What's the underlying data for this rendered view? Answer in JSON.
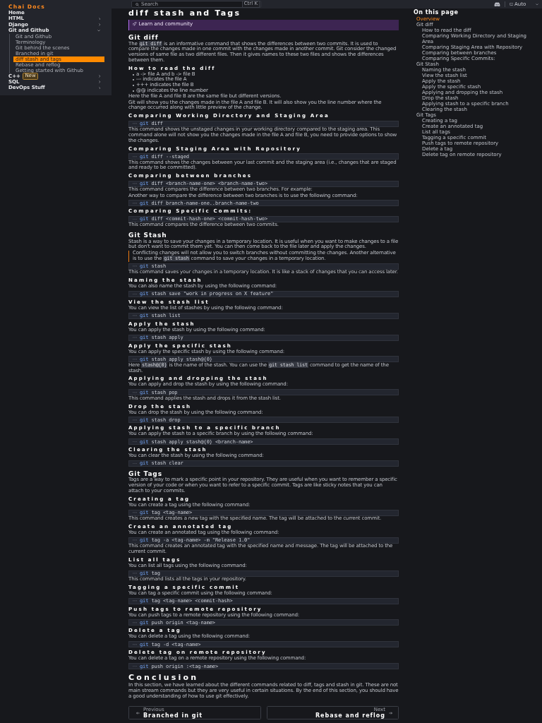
{
  "header": {
    "logo": "Chai Docs",
    "search": {
      "label": "Search",
      "shortcut": "Ctrl K"
    },
    "theme": {
      "value": "Auto"
    }
  },
  "sidebar": {
    "items": [
      {
        "label": "Home",
        "selected": false
      },
      {
        "label": "HTML",
        "selected": false,
        "expanded": false
      },
      {
        "label": "Django",
        "selected": false,
        "expanded": false
      },
      {
        "label": "Git and Github",
        "selected": false,
        "expanded": true,
        "children": [
          {
            "label": "Git and Github",
            "selected": false
          },
          {
            "label": "Terminology",
            "selected": false
          },
          {
            "label": "Git behind the scenes",
            "selected": false
          },
          {
            "label": "Branched in git",
            "selected": false
          },
          {
            "label": "diff stash and tags",
            "selected": true
          },
          {
            "label": "Rebase and reflog",
            "selected": false
          },
          {
            "label": "Getting started with Github",
            "selected": false
          }
        ]
      },
      {
        "label": "C++",
        "badge": "New",
        "selected": false,
        "expanded": false
      },
      {
        "label": "SQL",
        "selected": false,
        "expanded": false
      },
      {
        "label": "DevOps Stuff",
        "selected": false,
        "expanded": false
      }
    ]
  },
  "article": {
    "title": "diff stash and Tags",
    "blocks": [
      {
        "kind": "aside",
        "title": "Learn and community"
      },
      {
        "kind": "h2",
        "text": "Git diff"
      },
      {
        "kind": "p",
        "parts": [
          {
            "kind": "text",
            "text": "The "
          },
          {
            "kind": "code",
            "text": "git diff"
          },
          {
            "kind": "text",
            "text": " is an informative command that shows the differences between two commits. It is used to compare the changes made in one commit with the changes made in another commit. Git consider the changed versions of same file as two different files. Then it gives names to these two files and shows the differences between them."
          }
        ]
      },
      {
        "kind": "h3",
        "text": "How to read the diff"
      },
      {
        "kind": "list",
        "items": [
          "a -> file A and b -> file B",
          "--- indicates the file A",
          "+++ indicates the file B",
          "@@ indicates the line number"
        ]
      },
      {
        "kind": "p",
        "text": "Here the file A and file B are the same file but different versions."
      },
      {
        "kind": "p",
        "text": "Git will show you the changes made in the file A and file B. It will also show you the line number where the change occurred along with little preview of the change."
      },
      {
        "kind": "h3",
        "text": "Comparing Working Directory and Staging Area"
      },
      {
        "kind": "code",
        "text": "git diff"
      },
      {
        "kind": "p",
        "text": "This command shows the unstaged changes in your working directory compared to the staging area. This command alone will not show you the changes made in the file A and file B, you need to provide options to show the changes."
      },
      {
        "kind": "h3",
        "text": "Comparing Staging Area with Repository"
      },
      {
        "kind": "code",
        "text": "git diff --staged"
      },
      {
        "kind": "p",
        "text": "This command shows the changes between your last commit and the staging area (i.e., changes that are staged and ready to be committed)."
      },
      {
        "kind": "h3",
        "text": "Comparing between branches"
      },
      {
        "kind": "code",
        "text": "git diff <branch-name-one> <branch-name-two>"
      },
      {
        "kind": "p",
        "text": "This command compares the difference between two branches. For example:"
      },
      {
        "kind": "p",
        "text": "Another way to compare the difference between two branches is to use the following command:"
      },
      {
        "kind": "code",
        "text": "git diff branch-name-one..branch-name-two"
      },
      {
        "kind": "h3",
        "text": "Comparing Specific Commits:"
      },
      {
        "kind": "code",
        "text": "git diff <commit-hash-one> <commit-hash-two>"
      },
      {
        "kind": "p",
        "text": "This command compares the difference between two commits."
      },
      {
        "kind": "h2",
        "text": "Git Stash"
      },
      {
        "kind": "p",
        "text": "Stash is a way to save your changes in a temporary location. It is useful when you want to make changes to a file but don't want to commit them yet. You can then come back to the file later and apply the changes."
      },
      {
        "kind": "quote",
        "parts": [
          {
            "kind": "text",
            "text": "Conflicting changes will not allow you to switch branches without committing the changes. Another alternative is to use the "
          },
          {
            "kind": "code",
            "text": "git stash"
          },
          {
            "kind": "text",
            "text": " command to save your changes in a temporary location."
          }
        ]
      },
      {
        "kind": "code",
        "text": "git stash"
      },
      {
        "kind": "p",
        "text": "This command saves your changes in a temporary location. It is like a stack of changes that you can access later."
      },
      {
        "kind": "h3",
        "text": "Naming the stash"
      },
      {
        "kind": "p",
        "text": "You can also name the stash by using the following command:"
      },
      {
        "kind": "code",
        "text": "git stash save \"work in progress on X feature\""
      },
      {
        "kind": "h3",
        "text": "View the stash list"
      },
      {
        "kind": "p",
        "text": "You can view the list of stashes by using the following command:"
      },
      {
        "kind": "code",
        "text": "git stash list"
      },
      {
        "kind": "h3",
        "text": "Apply the stash"
      },
      {
        "kind": "p",
        "text": "You can apply the stash by using the following command:"
      },
      {
        "kind": "code",
        "text": "git stash apply"
      },
      {
        "kind": "h3",
        "text": "Apply the specific stash"
      },
      {
        "kind": "p",
        "text": "You can apply the specific stash by using the following command:"
      },
      {
        "kind": "code",
        "text": "git stash apply stash@{0}"
      },
      {
        "kind": "p",
        "parts": [
          {
            "kind": "text",
            "text": "Here "
          },
          {
            "kind": "code",
            "text": "stash@{0}"
          },
          {
            "kind": "text",
            "text": " is the name of the stash. You can use the "
          },
          {
            "kind": "code",
            "text": "git stash list"
          },
          {
            "kind": "text",
            "text": " command to get the name of the stash."
          }
        ]
      },
      {
        "kind": "h3",
        "text": "Applying and dropping the stash"
      },
      {
        "kind": "p",
        "text": "You can apply and drop the stash by using the following command:"
      },
      {
        "kind": "code",
        "text": "git stash pop"
      },
      {
        "kind": "p",
        "text": "This command applies the stash and drops it from the stash list."
      },
      {
        "kind": "h3",
        "text": "Drop the stash"
      },
      {
        "kind": "p",
        "text": "You can drop the stash by using the following command:"
      },
      {
        "kind": "code",
        "text": "git stash drop"
      },
      {
        "kind": "h3",
        "text": "Applying stash to a specific branch"
      },
      {
        "kind": "p",
        "text": "You can apply the stash to a specific branch by using the following command:"
      },
      {
        "kind": "code",
        "text": "git stash apply stash@{0} <branch-name>"
      },
      {
        "kind": "h3",
        "text": "Clearing the stash"
      },
      {
        "kind": "p",
        "text": "You can clear the stash by using the following command:"
      },
      {
        "kind": "code",
        "text": "git stash clear"
      },
      {
        "kind": "h2",
        "text": "Git Tags"
      },
      {
        "kind": "p",
        "text": "Tags are a way to mark a specific point in your repository. They are useful when you want to remember a specific version of your code or when you want to refer to a specific commit. Tags are like sticky notes that you can attach to your commits."
      },
      {
        "kind": "h3",
        "text": "Creating a tag"
      },
      {
        "kind": "p",
        "text": "You can create a tag using the following command:"
      },
      {
        "kind": "code",
        "text": "git tag <tag-name>"
      },
      {
        "kind": "p",
        "text": "This command creates a new tag with the specified name. The tag will be attached to the current commit."
      },
      {
        "kind": "h3",
        "text": "Create an annotated tag"
      },
      {
        "kind": "p",
        "text": "You can create an annotated tag using the following command:"
      },
      {
        "kind": "code",
        "text": "git tag -a <tag-name> -m \"Release 1.0\""
      },
      {
        "kind": "p",
        "text": "This command creates an annotated tag with the specified name and message. The tag will be attached to the current commit."
      },
      {
        "kind": "h3",
        "text": "List all tags"
      },
      {
        "kind": "p",
        "text": "You can list all tags using the following command:"
      },
      {
        "kind": "code",
        "text": "git tag"
      },
      {
        "kind": "p",
        "text": "This command lists all the tags in your repository."
      },
      {
        "kind": "h3",
        "text": "Tagging a specific commit"
      },
      {
        "kind": "p",
        "text": "You can tag a specific commit using the following command:"
      },
      {
        "kind": "code",
        "text": "git tag <tag-name> <commit-hash>"
      },
      {
        "kind": "h3",
        "text": "Push tags to remote repository"
      },
      {
        "kind": "p",
        "text": "You can push tags to a remote repository using the following command:"
      },
      {
        "kind": "code",
        "text": "git push origin <tag-name>"
      },
      {
        "kind": "h3",
        "text": "Delete a tag"
      },
      {
        "kind": "p",
        "text": "You can delete a tag using the following command:"
      },
      {
        "kind": "code",
        "text": "git tag -d <tag-name>"
      },
      {
        "kind": "h3",
        "text": "Delete tag on remote repository"
      },
      {
        "kind": "p",
        "text": "You can delete a tag on a remote repository using the following command:"
      },
      {
        "kind": "code",
        "text": "git push origin :<tag-name>"
      },
      {
        "kind": "h1",
        "text": "Conclusion"
      },
      {
        "kind": "p",
        "text": "In this section, we have learned about the different commands related to diff, tags and stash in git. These are not main stream commands but they are very useful in certain situations. By the end of this section, you should have a good understanding of how to use git effectively."
      }
    ]
  },
  "pagination": {
    "previous": {
      "caption": "Previous",
      "title": "Branched in git"
    },
    "next": {
      "caption": "Next",
      "title": "Rebase and reflog"
    }
  },
  "toc": {
    "title": "On this page",
    "items": [
      {
        "label": "Overview",
        "selected": true
      },
      {
        "label": "Git diff",
        "selected": false,
        "children": [
          {
            "label": "How to read the diff",
            "selected": false
          },
          {
            "label": "Comparing Working Directory and Staging Area",
            "selected": false
          },
          {
            "label": "Comparing Staging Area with Repository",
            "selected": false
          },
          {
            "label": "Comparing between branches",
            "selected": false
          },
          {
            "label": "Comparing Specific Commits:",
            "selected": false
          }
        ]
      },
      {
        "label": "Git Stash",
        "selected": false,
        "children": [
          {
            "label": "Naming the stash",
            "selected": false
          },
          {
            "label": "View the stash list",
            "selected": false
          },
          {
            "label": "Apply the stash",
            "selected": false
          },
          {
            "label": "Apply the specific stash",
            "selected": false
          },
          {
            "label": "Applying and dropping the stash",
            "selected": false
          },
          {
            "label": "Drop the stash",
            "selected": false
          },
          {
            "label": "Applying stash to a specific branch",
            "selected": false
          },
          {
            "label": "Clearing the stash",
            "selected": false
          }
        ]
      },
      {
        "label": "Git Tags",
        "selected": false,
        "children": [
          {
            "label": "Creating a tag",
            "selected": false
          },
          {
            "label": "Create an annotated tag",
            "selected": false
          },
          {
            "label": "List all tags",
            "selected": false
          },
          {
            "label": "Tagging a specific commit",
            "selected": false
          },
          {
            "label": "Push tags to remote repository",
            "selected": false
          },
          {
            "label": "Delete a tag",
            "selected": false
          },
          {
            "label": "Delete tag on remote repository",
            "selected": false
          }
        ]
      }
    ]
  }
}
